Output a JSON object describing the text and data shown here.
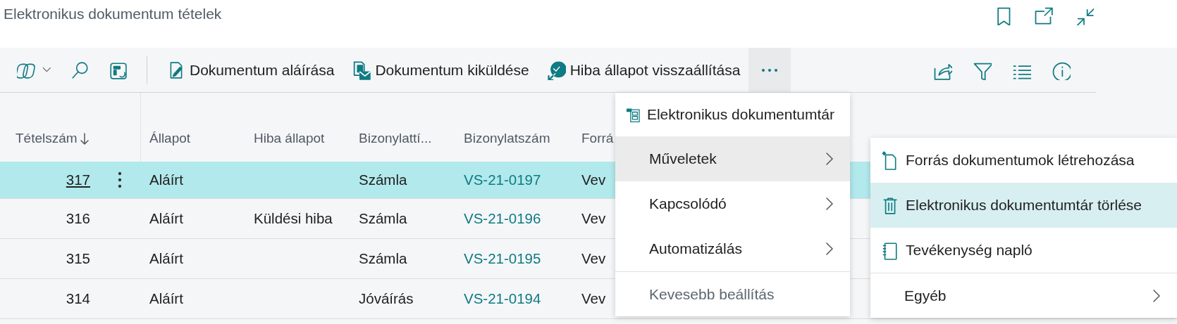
{
  "window": {
    "title": "Elektronikus dokumentum tételek"
  },
  "toolbar": {
    "actions": [
      {
        "label": "Dokumentum aláírása"
      },
      {
        "label": "Dokumentum kiküldése"
      },
      {
        "label": "Hiba állapot visszaállítása"
      }
    ],
    "more_expanded": true
  },
  "table": {
    "columns": [
      {
        "label": "Tételszám",
        "sorted_descending": true
      },
      {
        "label": "Állapot"
      },
      {
        "label": "Hiba állapot"
      },
      {
        "label": "Bizonylattí..."
      },
      {
        "label": "Bizonylatszám"
      },
      {
        "label": "Forrá"
      }
    ],
    "rows": [
      {
        "selected": true,
        "cells": [
          "317",
          "Aláírt",
          "",
          "Számla",
          "VS-21-0197",
          "Vev"
        ]
      },
      {
        "selected": false,
        "cells": [
          "316",
          "Aláírt",
          "Küldési hiba",
          "Számla",
          "VS-21-0196",
          "Vev"
        ]
      },
      {
        "selected": false,
        "cells": [
          "315",
          "Aláírt",
          "",
          "Számla",
          "VS-21-0195",
          "Vev"
        ]
      },
      {
        "selected": false,
        "cells": [
          "314",
          "Aláírt",
          "",
          "Jóváírás",
          "VS-21-0194",
          "Vev"
        ]
      }
    ]
  },
  "menu": {
    "items": [
      {
        "kind": "command",
        "label": "Elektronikus dokumentumtár",
        "selected": false
      },
      {
        "kind": "submenu",
        "label": "Műveletek",
        "selected": true
      },
      {
        "kind": "submenu",
        "label": "Kapcsolódó",
        "selected": false
      },
      {
        "kind": "submenu",
        "label": "Automatizálás",
        "selected": false
      },
      {
        "kind": "toggle",
        "label": "Kevesebb beállítás",
        "selected": false
      }
    ]
  },
  "submenu": {
    "items": [
      {
        "kind": "command",
        "label": "Forrás dokumentumok létrehozása",
        "selected": false
      },
      {
        "kind": "command",
        "label": "Elektronikus dokumentumtár törlése",
        "selected": true
      },
      {
        "kind": "command",
        "label": "Tevékenység napló",
        "selected": false
      },
      {
        "kind": "submenu",
        "label": "Egyéb",
        "selected": false
      }
    ]
  }
}
